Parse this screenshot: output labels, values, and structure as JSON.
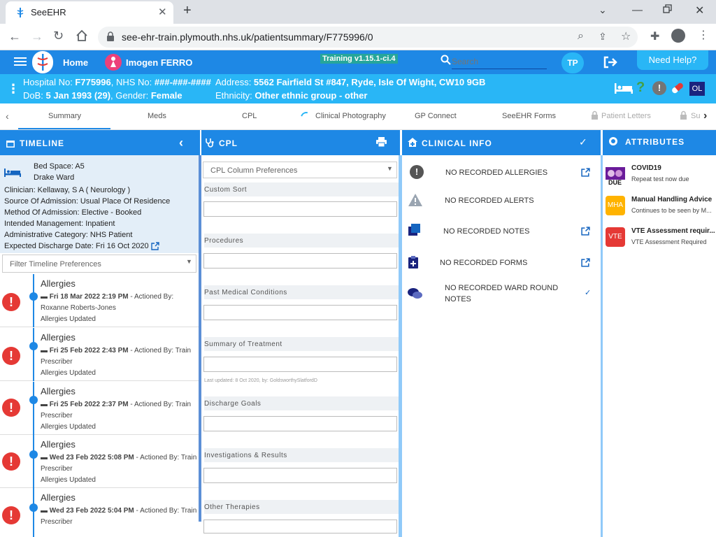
{
  "browser": {
    "tab_title": "SeeEHR",
    "url": "see-ehr-train.plymouth.nhs.uk/patientsummary/F775996/0"
  },
  "appbar": {
    "home_label": "Home",
    "patient_name": "Imogen FERRO",
    "training_label": "Training v1.15.1-ci.4",
    "search_placeholder": "Search",
    "user_initials": "TP",
    "help_label": "Need Help?",
    "ol_label": "OL"
  },
  "patient": {
    "hosp_label": "Hospital No: ",
    "hosp_no": "F775996",
    "nhs_label": ", NHS No: ",
    "nhs_no": "###-###-####",
    "address_label": "Address: ",
    "address": "5562 Fairfield St #847, Ryde, Isle Of Wight, CW10 9GB",
    "dob_label": "DoB: ",
    "dob": "5 Jan 1993 (29)",
    "gender_label": ", Gender: ",
    "gender": "Female",
    "ethnicity_label": "Ethnicity: ",
    "ethnicity": "Other ethnic group - other"
  },
  "navtabs": [
    "Summary",
    "Meds",
    "CPL",
    "Clinical Photography",
    "GP Connect",
    "SeeEHR Forms",
    "Patient Letters",
    "Su"
  ],
  "timeline": {
    "title": "TIMELINE",
    "bed_space": "Bed Space: A5",
    "ward": "Drake Ward",
    "details": [
      "Clinician: Kellaway, S A ( Neurology )",
      "Source Of Admission: Usual Place Of Residence",
      "Method Of Admission: Elective - Booked",
      "Intended Management: Inpatient",
      "Administrative Category: NHS Patient",
      "Expected Discharge Date: Fri 16 Oct 2020"
    ],
    "filter_placeholder": "Filter Timeline Preferences",
    "entries": [
      {
        "title": "Allergies",
        "date": "Fri 18 Mar 2022 2:19 PM",
        "by": " - Actioned By:",
        "by2": "Roxanne Roberts-Jones",
        "status": "Allergies Updated"
      },
      {
        "title": "Allergies",
        "date": "Fri 25 Feb 2022 2:43 PM",
        "by": " - Actioned By: Train",
        "by2": "Prescriber",
        "status": "Allergies Updated"
      },
      {
        "title": "Allergies",
        "date": "Fri 25 Feb 2022 2:37 PM",
        "by": " - Actioned By: Train",
        "by2": "Prescriber",
        "status": "Allergies Updated"
      },
      {
        "title": "Allergies",
        "date": "Wed 23 Feb 2022 5:08 PM",
        "by": " - Actioned By: Train",
        "by2": "Prescriber",
        "status": "Allergies Updated"
      },
      {
        "title": "Allergies",
        "date": "Wed 23 Feb 2022 5:04 PM",
        "by": " - Actioned By: Train",
        "by2": "Prescriber",
        "status": ""
      }
    ]
  },
  "cpl": {
    "title": "CPL",
    "column_prefs": "CPL Column Preferences",
    "sections": [
      "Custom Sort",
      "Procedures",
      "Past Medical Conditions",
      "Summary of Treatment",
      "Discharge Goals",
      "Investigations & Results",
      "Other Therapies"
    ],
    "last_updated": "Last updated: 8 Oct 2020, by: GoldsworthySlatfordD"
  },
  "clinical": {
    "title": "CLINICAL INFO",
    "items": [
      "NO RECORDED ALLERGIES",
      "NO RECORDED ALERTS",
      "NO RECORDED NOTES",
      "NO RECORDED FORMS",
      "NO RECORDED WARD ROUND",
      "NOTES"
    ]
  },
  "attributes": {
    "title": "ATTRIBUTES",
    "items": [
      {
        "badge": "DUE",
        "title": "COVID19",
        "sub": "Repeat test now due"
      },
      {
        "badge": "MHA",
        "title": "Manual Handling Advice",
        "sub": "Continues to be seen by M..."
      },
      {
        "badge": "VTE",
        "title": "VTE Assessment requir...",
        "sub": "VTE Assessment Required"
      }
    ]
  }
}
